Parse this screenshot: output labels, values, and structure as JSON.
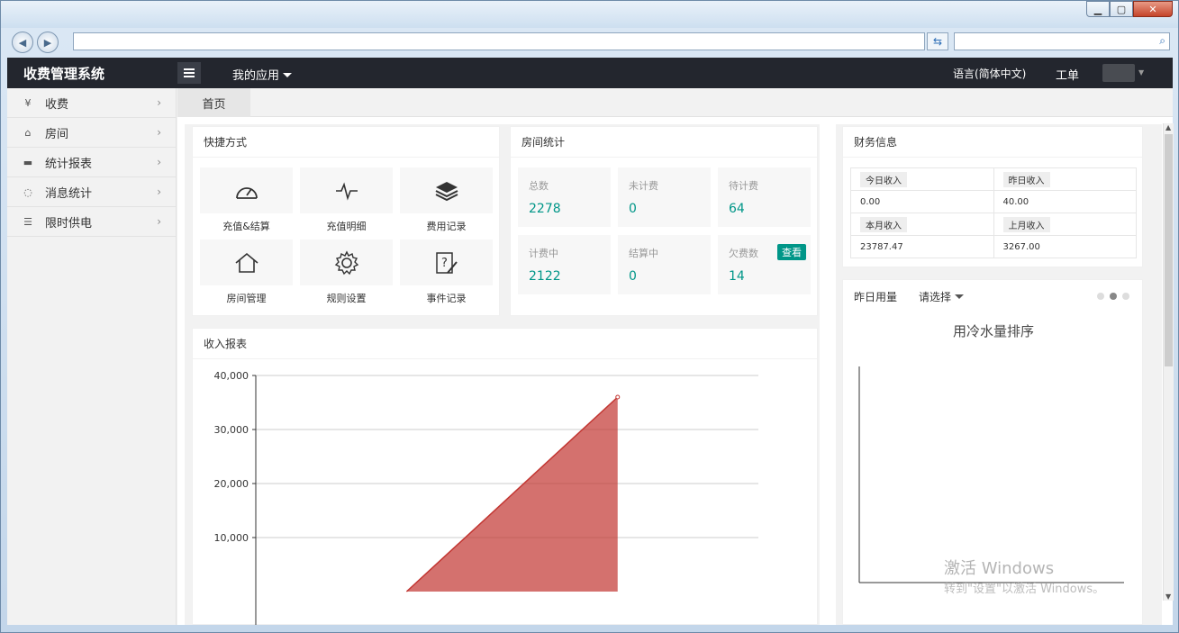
{
  "app": {
    "brand": "收费管理系统",
    "my_apps": "我的应用",
    "language": "语言(简体中文)",
    "ticket": "工单"
  },
  "sidebar": {
    "items": [
      {
        "label": "收费",
        "icon": "yen-icon"
      },
      {
        "label": "房间",
        "icon": "home-icon"
      },
      {
        "label": "统计报表",
        "icon": "monitor-icon"
      },
      {
        "label": "消息统计",
        "icon": "chat-icon"
      },
      {
        "label": "限时供电",
        "icon": "sliders-icon"
      }
    ]
  },
  "tabs": [
    {
      "label": "首页"
    }
  ],
  "quick": {
    "title": "快捷方式",
    "items": [
      {
        "label": "充值&结算",
        "icon": "gauge-icon"
      },
      {
        "label": "充值明细",
        "icon": "pulse-icon"
      },
      {
        "label": "费用记录",
        "icon": "layers-icon"
      },
      {
        "label": "房间管理",
        "icon": "home-icon"
      },
      {
        "label": "规则设置",
        "icon": "gear-icon"
      },
      {
        "label": "事件记录",
        "icon": "question-edit-icon"
      }
    ]
  },
  "room_stats": {
    "title": "房间统计",
    "items": [
      {
        "label": "总数",
        "value": "2278"
      },
      {
        "label": "未计费",
        "value": "0"
      },
      {
        "label": "待计费",
        "value": "64"
      },
      {
        "label": "计费中",
        "value": "2122"
      },
      {
        "label": "结算中",
        "value": "0"
      },
      {
        "label": "欠费数",
        "value": "14"
      }
    ],
    "view_badge": "查看"
  },
  "finance": {
    "title": "财务信息",
    "today_label": "今日收入",
    "today_value": "0.00",
    "yesterday_label": "昨日收入",
    "yesterday_value": "40.00",
    "month_label": "本月收入",
    "month_value": "23787.47",
    "last_month_label": "上月收入",
    "last_month_value": "3267.00"
  },
  "usage": {
    "title": "昨日用量",
    "select": "请选择",
    "chart_title": "用冷水量排序"
  },
  "income": {
    "title": "收入报表"
  },
  "chart_data": {
    "type": "area",
    "ylim": [
      0,
      40000
    ],
    "yticks": [
      "40,000",
      "30,000",
      "20,000",
      "10,000"
    ],
    "series": [
      {
        "color": "#c23531",
        "points": [
          [
            0.3,
            0
          ],
          [
            0.72,
            36000
          ]
        ]
      }
    ]
  },
  "watermark": {
    "line1": "激活 Windows",
    "line2": "转到\"设置\"以激活 Windows。"
  },
  "colors": {
    "accent": "#009688",
    "topbar": "#23262e",
    "chart": "#c23531"
  }
}
